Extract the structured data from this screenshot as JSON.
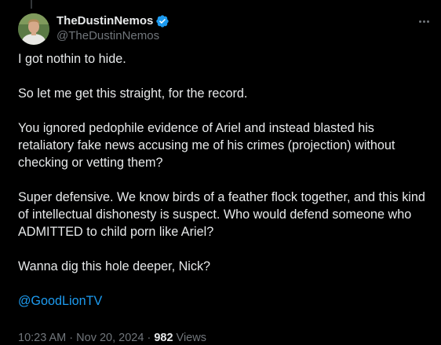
{
  "author": {
    "display_name": "TheDustinNemos",
    "handle": "@TheDustinNemos",
    "verified": true
  },
  "icons": {
    "verified": "verified-badge-icon",
    "more": "more-options-icon"
  },
  "colors": {
    "background": "#000000",
    "text": "#e7e9ea",
    "muted": "#71767b",
    "accent": "#1d9bf0"
  },
  "tweet": {
    "paragraphs": [
      "I got nothin to hide.",
      "So let me get this straight, for the record.",
      "You ignored pedophile evidence of Ariel and instead blasted his retaliatory fake news accusing me of his crimes (projection) without checking or vetting them?",
      "Super defensive. We know birds of a feather flock together, and this kind of intellectual dishonesty is suspect. Who would defend someone who ADMITTED to child porn like Ariel?",
      "Wanna dig this hole deeper, Nick?"
    ],
    "mention": "@GoodLionTV"
  },
  "meta": {
    "time": "10:23 AM",
    "separator": " · ",
    "date": "Nov 20, 2024",
    "views_count": "982",
    "views_label": " Views"
  }
}
